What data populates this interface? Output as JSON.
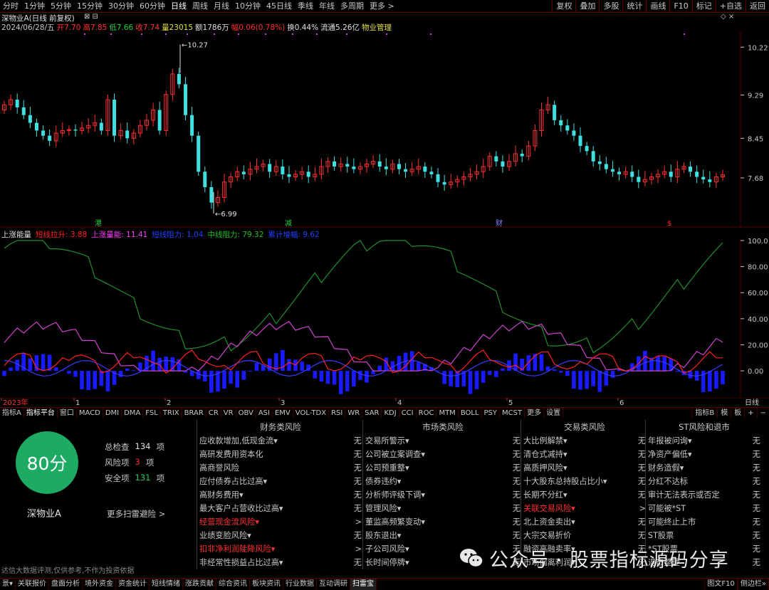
{
  "period_bar": {
    "items": [
      "分时",
      "1分钟",
      "5分钟",
      "15分钟",
      "30分钟",
      "60分钟",
      "日线",
      "周线",
      "月线",
      "10分钟",
      "45日线",
      "季线",
      "年线",
      "多周期",
      "更多 >"
    ],
    "active": "日线",
    "right_buttons": [
      "复权",
      "叠加",
      "多股",
      "统计",
      "画线",
      "F10",
      "标记",
      "+自选",
      "返回"
    ]
  },
  "header": {
    "stock_title": "深物业A(日线 前复权)",
    "date": "2024/06/28/五",
    "open_label": "开",
    "open": "7.70",
    "high_label": "高",
    "high": "7.85",
    "low_label": "低",
    "low": "7.66",
    "close_label": "收",
    "close": "7.74",
    "volume": "量23015",
    "amount": "额1786万",
    "change": "幅0.06(0.78%)",
    "turnover": "换0.44%",
    "float_cap": "流通5.26亿",
    "industry": "物业管理"
  },
  "kline": {
    "price_ticks": [
      "10.22",
      "9.29",
      "8.45",
      "7.68"
    ],
    "high_mark": "10.27",
    "low_mark": "6.99",
    "events": [
      "港",
      "减",
      "财",
      "$"
    ]
  },
  "indicator": {
    "name": "上涨能量",
    "items": [
      {
        "label": "短线拉升: 3.88",
        "color": "#ff2020"
      },
      {
        "label": "上涨量能: 11.41",
        "color": "#ff40ff"
      },
      {
        "label": "短线阻力: 1.04",
        "color": "#2040ff"
      },
      {
        "label": "中线阻力: 79.32",
        "color": "#20c020"
      },
      {
        "label": "累计增幅: 9.62",
        "color": "#2040ff"
      }
    ],
    "y_ticks": [
      "100.0",
      "80.00",
      "60.00",
      "40.00",
      "20.00",
      "0.00"
    ]
  },
  "x_axis": {
    "labels": [
      "2023年",
      "1",
      "2",
      "3",
      "4",
      "5",
      "6"
    ],
    "right_label": "日线"
  },
  "indicator_tabs": {
    "items": [
      "指标A",
      "指标平台",
      "窗口",
      "MACD",
      "DMI",
      "DMA",
      "FSL",
      "TRIX",
      "BRAR",
      "CR",
      "VR",
      "OBV",
      "ASI",
      "EMV",
      "VOL-TDX",
      "RSI",
      "WR",
      "SAR",
      "KDJ",
      "CCI",
      "ROC",
      "MTM",
      "BOLL",
      "PSY",
      "MCST",
      "更多",
      "设置"
    ],
    "active": "指标平台",
    "right": [
      "指标B",
      "模",
      "板",
      "+",
      "−"
    ]
  },
  "risk": {
    "score": "80分",
    "stock_name": "深物业A",
    "total_label": "总检查",
    "total_value": "134",
    "total_unit": "项",
    "risk_label": "风险项",
    "risk_value": "3",
    "risk_unit": "项",
    "safe_label": "安全项",
    "safe_value": "131",
    "safe_unit": "项",
    "more_link": "更多扫雷避险 >",
    "disclaimer": "达信大数据评测,仅供参考,不作为投资依据",
    "columns": [
      {
        "title": "财务类风险",
        "rows": [
          {
            "label": "应收款增加,低现金流▾",
            "value": "无",
            "hl": false
          },
          {
            "label": "高研发费用资本化",
            "value": "无",
            "hl": false
          },
          {
            "label": "高商誉风险",
            "value": "无",
            "hl": false
          },
          {
            "label": "应付债券占比过高▾",
            "value": "无",
            "hl": false
          },
          {
            "label": "高财务费用▾",
            "value": "无",
            "hl": false
          },
          {
            "label": "最大客户占营收比过高▾",
            "value": "无",
            "hl": false
          },
          {
            "label": "经营现金流风险▾",
            "value": ">",
            "hl": true
          },
          {
            "label": "业绩变脸风险▾",
            "value": "无",
            "hl": false
          },
          {
            "label": "扣非净利润陡降风险▾",
            "value": ">",
            "hl": true
          },
          {
            "label": "非经常性损益占比过高▾",
            "value": "无",
            "hl": false
          }
        ]
      },
      {
        "title": "市场类风险",
        "rows": [
          {
            "label": "交易所警示▾",
            "value": "无",
            "hl": false
          },
          {
            "label": "公司被立案调查▾",
            "value": "无",
            "hl": false
          },
          {
            "label": "公司预重整▾",
            "value": "无",
            "hl": false
          },
          {
            "label": "债券违约▾",
            "value": "无",
            "hl": false
          },
          {
            "label": "分析师评级下调▾",
            "value": "无",
            "hl": false
          },
          {
            "label": "管理风险▾",
            "value": "无",
            "hl": false
          },
          {
            "label": "董监高频繁变动▾",
            "value": "无",
            "hl": false
          },
          {
            "label": "股东退出▾",
            "value": "无",
            "hl": false
          },
          {
            "label": "子公司风险▾",
            "value": "无",
            "hl": false
          },
          {
            "label": "长时间停牌▾",
            "value": "无",
            "hl": false
          }
        ]
      },
      {
        "title": "交易类风险",
        "rows": [
          {
            "label": "大比例解禁▾",
            "value": "无",
            "hl": false
          },
          {
            "label": "清仓式减持▾",
            "value": "无",
            "hl": false
          },
          {
            "label": "高质押风险▾",
            "value": "无",
            "hl": false
          },
          {
            "label": "十大股东总持股占比小▾",
            "value": "无",
            "hl": false
          },
          {
            "label": "长期不分红▾",
            "value": "无",
            "hl": false
          },
          {
            "label": "关联交易风险▾",
            "value": ">",
            "hl": true
          },
          {
            "label": "北上资金卖出▾",
            "value": "无",
            "hl": false
          },
          {
            "label": "大宗交易折价",
            "value": "无",
            "hl": false
          },
          {
            "label": "融资高融卖率▾",
            "value": "无",
            "hl": false
          },
          {
            "label": "市场偏离利润▾",
            "value": "无",
            "hl": false
          }
        ]
      },
      {
        "title": "ST风险和退市",
        "rows": [
          {
            "label": "年报被问询▾",
            "value": "无",
            "hl": false
          },
          {
            "label": "净资产偏低▾",
            "value": "无",
            "hl": false
          },
          {
            "label": "财务造假▾",
            "value": "无",
            "hl": false
          },
          {
            "label": "分红不达标",
            "value": "无",
            "hl": false
          },
          {
            "label": "审计无法表示或否定",
            "value": "无",
            "hl": false
          },
          {
            "label": "可能被*ST",
            "value": "无",
            "hl": false
          },
          {
            "label": "可能终止上市",
            "value": "无",
            "hl": false
          },
          {
            "label": "ST股票",
            "value": "无",
            "hl": false
          },
          {
            "label": "*ST股票",
            "value": "无",
            "hl": false
          },
          {
            "label": "退市整理",
            "value": "无",
            "hl": false
          }
        ]
      }
    ]
  },
  "watermark": "公众号 · 股票指标源码分享",
  "bottom_tabs": {
    "items": [
      "景▾",
      "关联报价",
      "盘面分析",
      "境外资金",
      "资金统计",
      "短线情绪",
      "涨跌贡献",
      "综合资讯",
      "板块资讯",
      "行业数据",
      "互动调研",
      "扫雷宝"
    ],
    "active": "扫雷宝",
    "right": [
      "图文F10",
      "侧边栏»"
    ]
  },
  "colors": {
    "up": "#ff3030",
    "down": "#40e0e0",
    "bg": "#000000",
    "grid": "#5a0000",
    "score_bg": "#1daa63"
  }
}
